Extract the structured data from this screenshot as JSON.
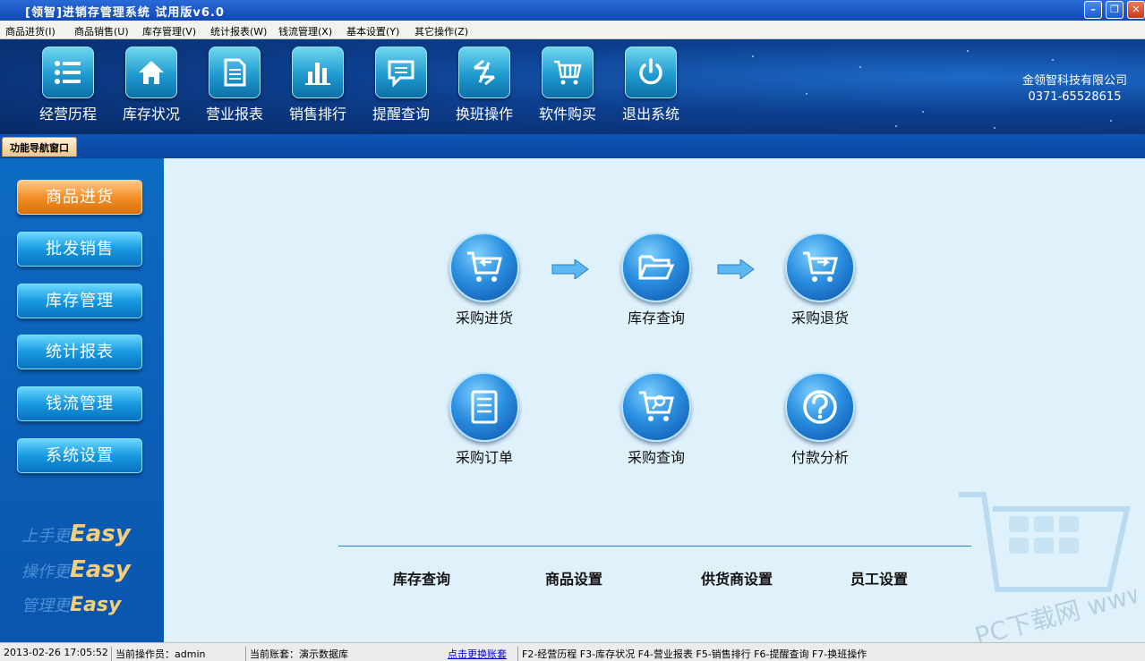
{
  "window": {
    "title": "[领智]进销存管理系统 试用版v6.0"
  },
  "menu": [
    "商品进货(I)",
    "商品销售(U)",
    "库存管理(V)",
    "统计报表(W)",
    "钱流管理(X)",
    "基本设置(Y)",
    "其它操作(Z)"
  ],
  "toolbar": [
    {
      "label": "经营历程",
      "icon": "list-icon"
    },
    {
      "label": "库存状况",
      "icon": "home-icon"
    },
    {
      "label": "营业报表",
      "icon": "document-icon"
    },
    {
      "label": "销售排行",
      "icon": "bar-chart-icon"
    },
    {
      "label": "提醒查询",
      "icon": "message-icon"
    },
    {
      "label": "换班操作",
      "icon": "exchange-icon"
    },
    {
      "label": "软件购买",
      "icon": "cart-icon"
    },
    {
      "label": "退出系统",
      "icon": "power-icon"
    }
  ],
  "company": {
    "name": "金领智科技有限公司",
    "phone": "0371-65528615"
  },
  "nav_tab": "功能导航窗口",
  "sidebar": {
    "items": [
      "商品进货",
      "批发销售",
      "库存管理",
      "统计报表",
      "钱流管理",
      "系统设置"
    ],
    "active_index": 0,
    "slogans": [
      {
        "text": "上手更",
        "em": "Easy"
      },
      {
        "text": "操作更",
        "em": "Easy"
      },
      {
        "text": "管理更",
        "em": "Easy"
      }
    ]
  },
  "main": {
    "functions": [
      {
        "label": "采购进货",
        "icon": "cart-in-icon"
      },
      {
        "label": "库存查询",
        "icon": "folder-icon"
      },
      {
        "label": "采购退货",
        "icon": "cart-return-icon"
      },
      {
        "label": "采购订单",
        "icon": "order-icon"
      },
      {
        "label": "采购查询",
        "icon": "cart-search-icon"
      },
      {
        "label": "付款分析",
        "icon": "question-icon"
      }
    ],
    "links": [
      "库存查询",
      "商品设置",
      "供货商设置",
      "员工设置"
    ],
    "watermark": "PC下载网 www.pcsoft.com.cn"
  },
  "status": {
    "datetime": "2013-02-26 17:05:52",
    "operator": "当前操作员：admin",
    "account": "当前账套：演示数据库",
    "switch_link": "点击更换账套",
    "shortcuts": "F2-经营历程 F3-库存状况 F4-营业报表 F5-销售排行 F6-提醒查询 F7-换班操作"
  },
  "colors": {
    "accent": "#1799e0",
    "active": "#f39028",
    "header_bg": "#0d3f8f"
  }
}
